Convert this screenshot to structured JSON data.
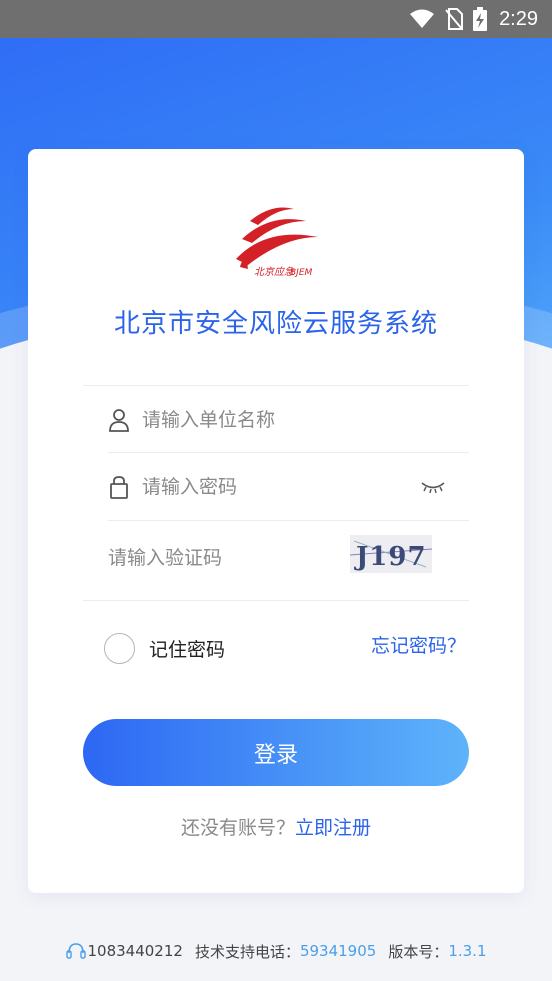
{
  "status_bar": {
    "time": "2:29",
    "icons": [
      "wifi-icon",
      "no-sim-icon",
      "battery-charging-icon"
    ]
  },
  "card": {
    "logo_text": "北京应急",
    "logo_text_sub": "BJEM",
    "title": "北京市安全风险云服务系统",
    "unit_placeholder": "请输入单位名称",
    "password_placeholder": "请输入密码",
    "captcha_placeholder": "请输入验证码",
    "captcha_text": "J197",
    "remember_label": "记住密码",
    "forgot_label": "忘记密码？",
    "login_label": "登录",
    "register_question": "还没有账号？",
    "register_link": "立即注册"
  },
  "footer": {
    "phone_text": "1083440212",
    "support_label": "技术支持电话：",
    "support_number": "59341905",
    "version_label": "版本号：",
    "version_number": "1.3.1"
  },
  "colors": {
    "accent": "#2b63ea",
    "gradient_start": "#2d67f4",
    "gradient_end": "#5eb3fb",
    "logo_red": "#d42027"
  }
}
